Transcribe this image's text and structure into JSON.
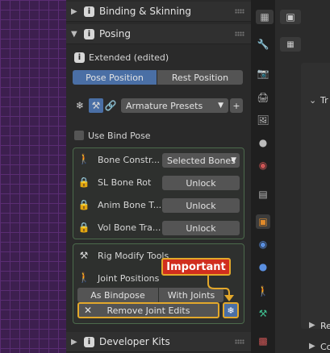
{
  "sections": {
    "binding": {
      "title": "Binding & Skinning"
    },
    "posing": {
      "title": "Posing"
    },
    "developer": {
      "title": "Developer Kits"
    }
  },
  "posing": {
    "extended": "Extended (edited)",
    "pose_position": "Pose Position",
    "rest_position": "Rest Position",
    "armature_presets": "Armature Presets",
    "add": "+",
    "use_bind_pose": "Use Bind Pose",
    "bone_constr": {
      "label": "Bone Constr...",
      "value": "Selected Bones"
    },
    "sl_bone_rot": {
      "label": "SL Bone Rot",
      "button": "Unlock"
    },
    "anim_bone": {
      "label": "Anim Bone T...",
      "button": "Unlock"
    },
    "vol_bone": {
      "label": "Vol Bone Tra...",
      "button": "Unlock"
    },
    "rig_modify": "Rig Modify Tools",
    "joint_positions": "Joint Positions",
    "as_bindpose": "As Bindpose",
    "with_joints": "With Joints",
    "remove_joint_edits": "Remove Joint Edits",
    "callout": "Important"
  },
  "props": {
    "tr": "Tr",
    "re": "Re",
    "co": "Co"
  },
  "colors": {
    "accent": "#4a6fa5",
    "highlight": "#e3a82b",
    "callout_bg": "#d12e1e"
  }
}
